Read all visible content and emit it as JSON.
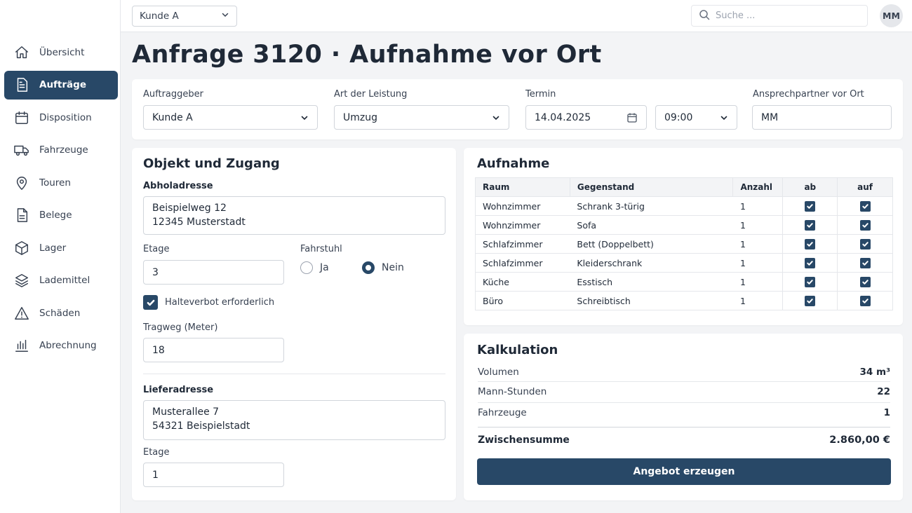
{
  "sidebar": {
    "items": [
      {
        "label": "Übersicht",
        "icon": "home-icon",
        "active": false
      },
      {
        "label": "Aufträge",
        "icon": "document-icon",
        "active": true
      },
      {
        "label": "Disposition",
        "icon": "calendar-icon",
        "active": false
      },
      {
        "label": "Fahrzeuge",
        "icon": "truck-icon",
        "active": false
      },
      {
        "label": "Touren",
        "icon": "map-pin-icon",
        "active": false
      },
      {
        "label": "Belege",
        "icon": "receipt-icon",
        "active": false
      },
      {
        "label": "Lager",
        "icon": "box-icon",
        "active": false
      },
      {
        "label": "Lademittel",
        "icon": "layers-icon",
        "active": false
      },
      {
        "label": "Schäden",
        "icon": "warning-icon",
        "active": false
      },
      {
        "label": "Abrechnung",
        "icon": "bar-chart-icon",
        "active": false
      }
    ]
  },
  "topbar": {
    "client_select": "Kunde A",
    "search_placeholder": "Suche ...",
    "avatar": "MM"
  },
  "page": {
    "title": "Anfrage 3120 · Aufnahme vor Ort"
  },
  "header_form": {
    "auftraggeber_label": "Auftraggeber",
    "auftraggeber_value": "Kunde A",
    "leistung_label": "Art der Leistung",
    "leistung_value": "Umzug",
    "termin_label": "Termin",
    "termin_date": "14.04.2025",
    "termin_time": "09:00",
    "ansprech_label": "Ansprechpartner vor Ort",
    "ansprech_value": "MM"
  },
  "objekt": {
    "title": "Objekt und Zugang",
    "abhol_label": "Abholadresse",
    "abhol_line1": "Beispielweg 12",
    "abhol_line2": "12345 Musterstadt",
    "etage_label": "Etage",
    "etage_value": "3",
    "fahrstuhl_label": "Fahrstuhl",
    "fahrstuhl_ja": "Ja",
    "fahrstuhl_nein": "Nein",
    "fahrstuhl_selected": "Nein",
    "halteverbot_label": "Halteverbot erforderlich",
    "halteverbot_checked": true,
    "tragweg_label": "Tragweg (Meter)",
    "tragweg_value": "18",
    "liefer_label": "Lieferadresse",
    "liefer_line1": "Musterallee 7",
    "liefer_line2": "54321 Beispielstadt",
    "liefer_etage_label": "Etage",
    "liefer_etage_value": "1"
  },
  "aufnahme": {
    "title": "Aufnahme",
    "columns": [
      "Raum",
      "Gegenstand",
      "Anzahl",
      "ab",
      "auf"
    ],
    "rows": [
      {
        "raum": "Wohnzimmer",
        "gegenstand": "Schrank 3-türig",
        "anzahl": "1",
        "ab": true,
        "auf": true
      },
      {
        "raum": "Wohnzimmer",
        "gegenstand": "Sofa",
        "anzahl": "1",
        "ab": true,
        "auf": true
      },
      {
        "raum": "Schlafzimmer",
        "gegenstand": "Bett (Doppelbett)",
        "anzahl": "1",
        "ab": true,
        "auf": true
      },
      {
        "raum": "Schlafzimmer",
        "gegenstand": "Kleiderschrank",
        "anzahl": "1",
        "ab": true,
        "auf": true
      },
      {
        "raum": "Küche",
        "gegenstand": "Esstisch",
        "anzahl": "1",
        "ab": true,
        "auf": true
      },
      {
        "raum": "Büro",
        "gegenstand": "Schreibtisch",
        "anzahl": "1",
        "ab": true,
        "auf": true
      }
    ]
  },
  "kalkulation": {
    "title": "Kalkulation",
    "rows": [
      {
        "label": "Volumen",
        "value": "34 m³"
      },
      {
        "label": "Mann-Stunden",
        "value": "22"
      },
      {
        "label": "Fahrzeuge",
        "value": "1"
      }
    ],
    "sum_label": "Zwischensumme",
    "sum_value": "2.860,00 €",
    "button_label": "Angebot erzeugen"
  },
  "colors": {
    "accent": "#284867",
    "background": "#f3f4f6"
  }
}
